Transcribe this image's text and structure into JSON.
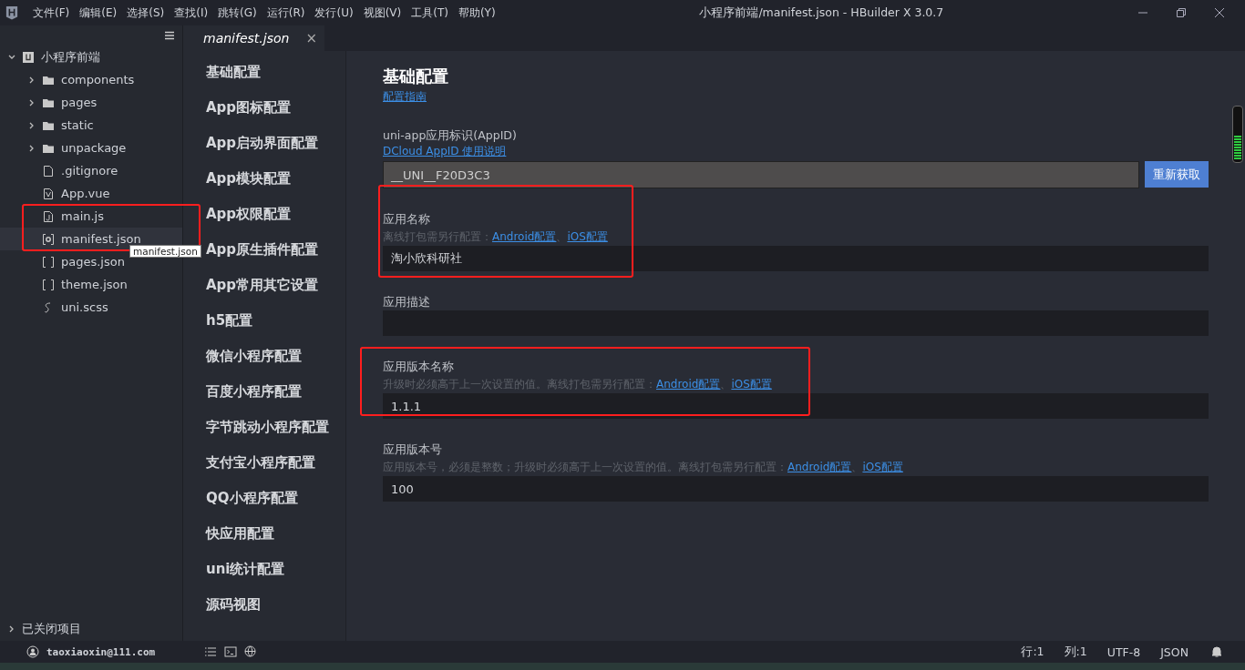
{
  "window": {
    "title": "小程序前端/manifest.json - HBuilder X 3.0.7"
  },
  "menu": [
    "文件(F)",
    "编辑(E)",
    "选择(S)",
    "查找(I)",
    "跳转(G)",
    "运行(R)",
    "发行(U)",
    "视图(V)",
    "工具(T)",
    "帮助(Y)"
  ],
  "sidebar": {
    "project": {
      "name": "小程序前端",
      "expanded": true,
      "children": [
        {
          "name": "components",
          "kind": "folder",
          "expanded": false,
          "selected": false
        },
        {
          "name": "pages",
          "kind": "folder",
          "expanded": false,
          "selected": false
        },
        {
          "name": "static",
          "kind": "folder",
          "expanded": false,
          "selected": false
        },
        {
          "name": "unpackage",
          "kind": "folder",
          "expanded": false,
          "selected": false
        },
        {
          "name": ".gitignore",
          "kind": "file",
          "selected": false
        },
        {
          "name": "App.vue",
          "kind": "vue",
          "selected": false
        },
        {
          "name": "main.js",
          "kind": "js",
          "selected": false
        },
        {
          "name": "manifest.json",
          "kind": "config",
          "selected": true,
          "highlighted": true
        },
        {
          "name": "pages.json",
          "kind": "json",
          "selected": false
        },
        {
          "name": "theme.json",
          "kind": "json",
          "selected": false
        },
        {
          "name": "uni.scss",
          "kind": "style",
          "selected": false
        }
      ]
    },
    "tooltip": "manifest.json",
    "closed_projects": {
      "label": "已关闭项目",
      "expanded": false
    }
  },
  "tabs": [
    {
      "label": "manifest.json",
      "selected": true,
      "close": "×"
    }
  ],
  "nav": [
    "基础配置",
    "App图标配置",
    "App启动界面配置",
    "App模块配置",
    "App权限配置",
    "App原生插件配置",
    "App常用其它设置",
    "h5配置",
    "微信小程序配置",
    "百度小程序配置",
    "字节跳动小程序配置",
    "支付宝小程序配置",
    "QQ小程序配置",
    "快应用配置",
    "uni统计配置",
    "源码视图"
  ],
  "content": {
    "title": "基础配置",
    "guide_link": "配置指南",
    "fields": [
      {
        "kind": "appid",
        "label": "uni-app应用标识(AppID)",
        "link": "DCloud AppID 使用说明",
        "value": "__UNI__F20D3C3",
        "button": "重新获取"
      },
      {
        "kind": "text",
        "label": "应用名称",
        "hint": "离线打包需另行配置：",
        "links": [
          "Android配置",
          "iOS配置"
        ],
        "value": "淘小欣科研社",
        "highlighted": true
      },
      {
        "kind": "text",
        "label": "应用描述"
      },
      {
        "kind": "text",
        "label": "应用版本名称",
        "hint": "升级时必须高于上一次设置的值。离线打包需另行配置：",
        "links": [
          "Android配置",
          "iOS配置"
        ],
        "value": "1.1.1",
        "highlighted": true
      },
      {
        "kind": "text",
        "label": "应用版本号",
        "hint": "应用版本号，必须是整数；升级时必须高于上一次设置的值。离线打包需另行配置：",
        "links": [
          "Android配置",
          "iOS配置"
        ],
        "value": "100"
      }
    ],
    "link_separator": "、"
  },
  "status_bar": {
    "user": "taoxiaoxin@111.com",
    "line": "行:1",
    "column": "列:1",
    "encoding": "UTF-8",
    "language": "JSON"
  }
}
